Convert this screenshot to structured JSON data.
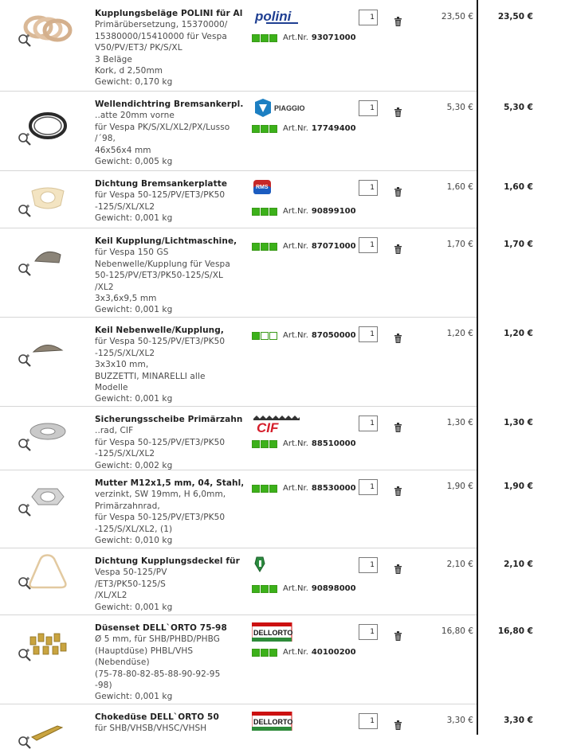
{
  "cart": {
    "currency_note": "€",
    "art_label": "Art.Nr.",
    "rows": [
      {
        "title": "Kupplungsbeläge POLINI für Alu",
        "lines": [
          "Primärübersetzung, 15370000/",
          "15380000/15410000 für Vespa",
          "V50/PV/ET3/ PK/S/XL",
          "3 Beläge",
          "Kork, d 2,50mm",
          "Gewicht: 0,170 kg"
        ],
        "brand": "polini",
        "brand_text": "polini",
        "availability": 3,
        "art_nr": "93071000",
        "qty": "1",
        "price": "23,50 €",
        "total": "23,50 €"
      },
      {
        "title": "Wellendichtring Bremsankerpl..",
        "lines": [
          "..atte 20mm vorne",
          "für Vespa PK/S/XL/XL2/PX/Lusso",
          "/´98,",
          "46x56x4 mm",
          "Gewicht: 0,005 kg"
        ],
        "brand": "piaggio",
        "brand_text": "PIAGGIO",
        "availability": 3,
        "art_nr": "17749400",
        "qty": "1",
        "price": "5,30 €",
        "total": "5,30 €"
      },
      {
        "title": "Dichtung Bremsankerplatte",
        "lines": [
          "für Vespa 50-125/PV/ET3/PK50",
          "-125/S/XL/XL2",
          "Gewicht: 0,001 kg"
        ],
        "brand": "rms",
        "brand_text": "RMS",
        "availability": 3,
        "art_nr": "90899100",
        "qty": "1",
        "price": "1,60 €",
        "total": "1,60 €"
      },
      {
        "title": "Keil Kupplung/Lichtmaschine,",
        "lines": [
          "für Vespa 150 GS",
          "Nebenwelle/Kupplung für Vespa",
          "50-125/PV/ET3/PK50-125/S/XL",
          "/XL2",
          "3x3,6x9,5 mm",
          "Gewicht: 0,001 kg"
        ],
        "brand": "",
        "brand_text": "",
        "availability": 3,
        "art_nr": "87071000",
        "qty": "1",
        "price": "1,70 €",
        "total": "1,70 €"
      },
      {
        "title": "Keil Nebenwelle/Kupplung,",
        "lines": [
          "für Vespa 50-125/PV/ET3/PK50",
          "-125/S/XL/XL2",
          "3x3x10 mm,",
          "BUZZETTI, MINARELLI alle",
          "Modelle",
          "Gewicht: 0,001 kg"
        ],
        "brand": "",
        "brand_text": "",
        "availability": 1,
        "art_nr": "87050000",
        "qty": "1",
        "price": "1,20 €",
        "total": "1,20 €"
      },
      {
        "title": "Sicherungsscheibe Primärzahn..",
        "lines": [
          "..rad, CIF",
          "für Vespa 50-125/PV/ET3/PK50",
          "-125/S/XL/XL2",
          "Gewicht: 0,002 kg"
        ],
        "brand": "cif",
        "brand_text": "CIF",
        "availability": 3,
        "art_nr": "88510000",
        "qty": "1",
        "price": "1,30 €",
        "total": "1,30 €"
      },
      {
        "title": "Mutter M12x1,5 mm, 04, Stahl,",
        "lines": [
          "verzinkt, SW 19mm, H 6,0mm,",
          "Primärzahnrad,",
          "für Vespa 50-125/PV/ET3/PK50",
          "-125/S/XL/XL2, (1)",
          "Gewicht: 0,010 kg"
        ],
        "brand": "",
        "brand_text": "",
        "availability": 3,
        "art_nr": "88530000",
        "qty": "1",
        "price": "1,90 €",
        "total": "1,90 €"
      },
      {
        "title": "Dichtung Kupplungsdeckel für",
        "lines": [
          "Vespa 50-125/PV",
          "/ET3/PK50-125/S",
          "/XL/XL2",
          "Gewicht: 0,001 kg"
        ],
        "brand": "shield",
        "brand_text": "",
        "availability": 3,
        "art_nr": "90898000",
        "qty": "1",
        "price": "2,10 €",
        "total": "2,10 €"
      },
      {
        "title": "Düsenset DELL`ORTO 75-98",
        "lines": [
          "Ø 5 mm, für SHB/PHBD/PHBG",
          "(Hauptdüse) PHBL/VHS",
          "(Nebendüse)",
          "(75-78-80-82-85-88-90-92-95",
          "-98)",
          "Gewicht: 0,001 kg"
        ],
        "brand": "dellorto",
        "brand_text": "DELLORTO",
        "availability": 3,
        "art_nr": "40100200",
        "qty": "1",
        "price": "16,80 €",
        "total": "16,80 €"
      },
      {
        "title": "Chokedüse DELL`ORTO 50",
        "lines": [
          "für SHB/VHSB/VHSC/VHSH"
        ],
        "brand": "dellorto",
        "brand_text": "DELLORTO",
        "availability": 0,
        "art_nr": "",
        "qty": "1",
        "price": "3,30 €",
        "total": "3,30 €"
      }
    ]
  }
}
